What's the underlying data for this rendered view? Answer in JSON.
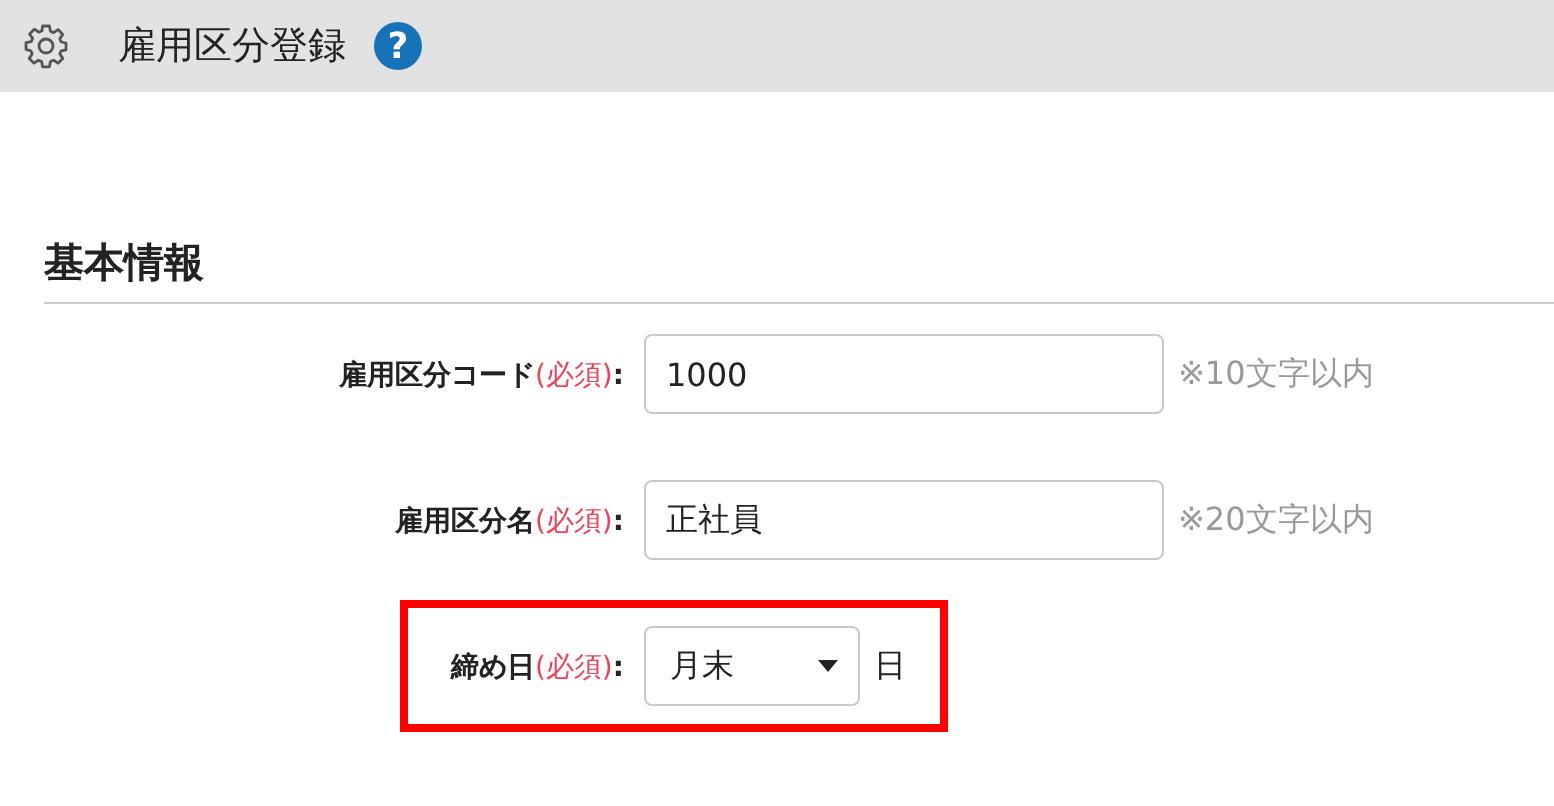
{
  "header": {
    "title": "雇用区分登録",
    "help": "?"
  },
  "section": {
    "title": "基本情報"
  },
  "fields": [
    {
      "kind": "text",
      "label": "雇用区分コード",
      "required": "(必須)",
      "colon": ":",
      "value": "1000",
      "hint": "※10文字以内",
      "highlighted": false
    },
    {
      "kind": "text",
      "label": "雇用区分名",
      "required": "(必須)",
      "colon": ":",
      "value": "正社員",
      "hint": "※20文字以内",
      "highlighted": false
    },
    {
      "kind": "select",
      "label": "締め日",
      "required": "(必須)",
      "colon": ":",
      "value": "月末",
      "suffix": "日",
      "highlighted": true
    }
  ]
}
